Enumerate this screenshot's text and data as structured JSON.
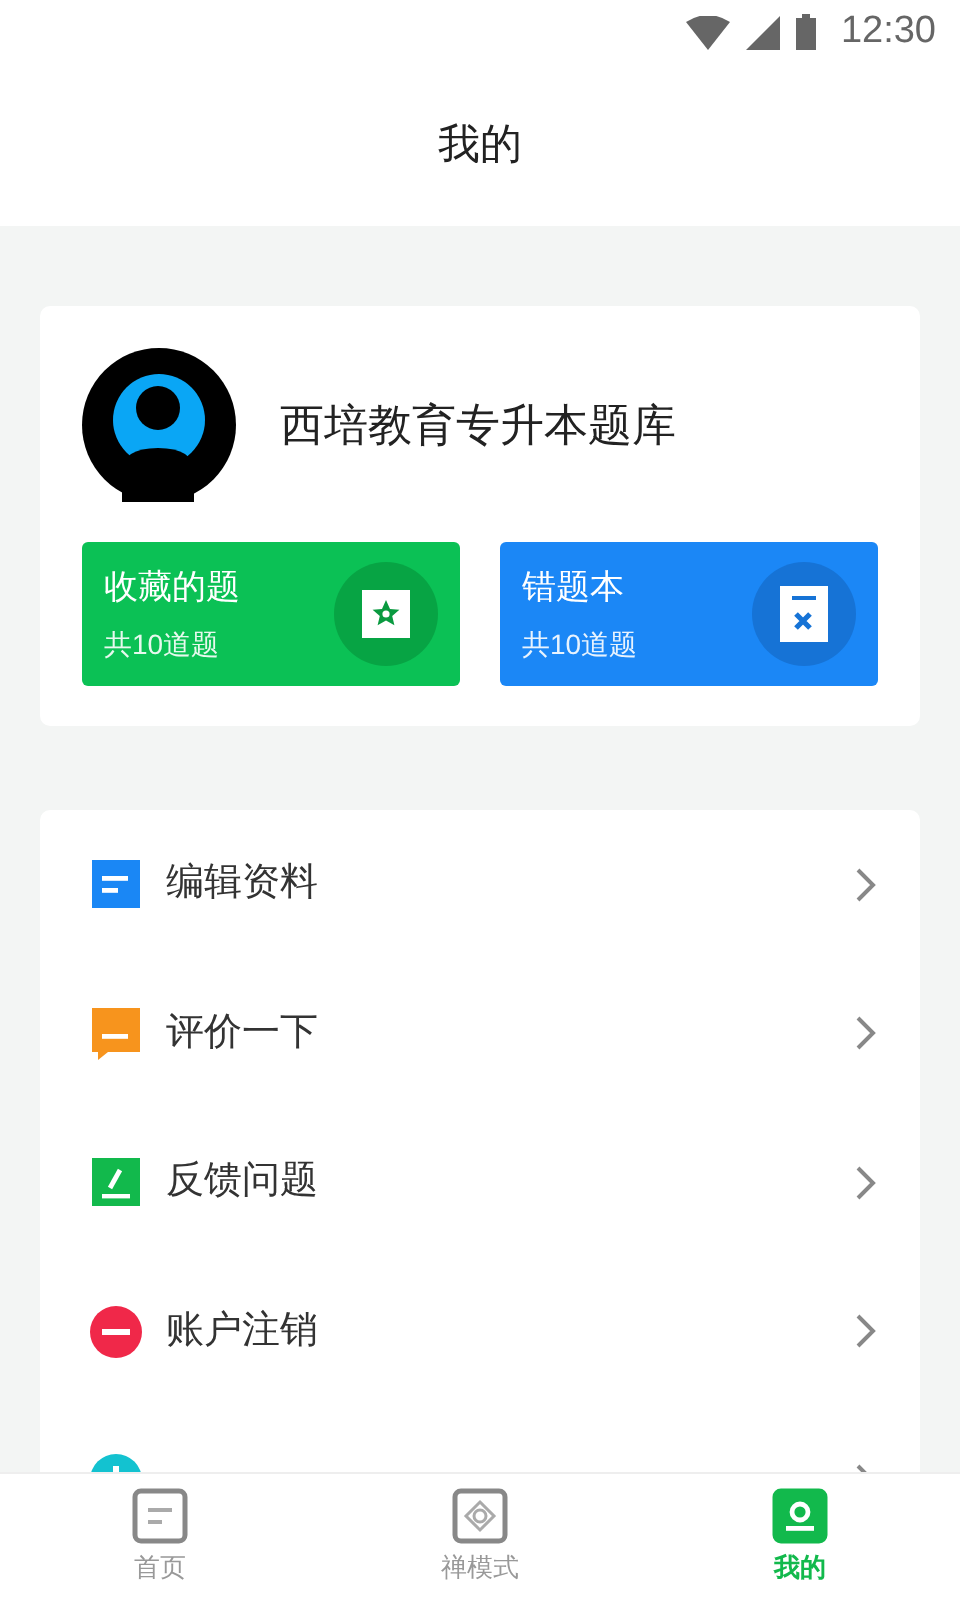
{
  "status_bar": {
    "time": "12:30"
  },
  "header": {
    "title": "我的"
  },
  "profile": {
    "name": "西培教育专升本题库"
  },
  "shortcuts": [
    {
      "kind": "favorites",
      "title": "收藏的题",
      "count": "共10道题"
    },
    {
      "kind": "mistakes",
      "title": "错题本",
      "count": "共10道题"
    }
  ],
  "menu": [
    {
      "kind": "edit-profile",
      "label": "编辑资料"
    },
    {
      "kind": "rate",
      "label": "评价一下"
    },
    {
      "kind": "feedback",
      "label": "反馈问题"
    },
    {
      "kind": "delete-account",
      "label": "账户注销"
    },
    {
      "kind": "about"
    }
  ],
  "tabs": [
    {
      "kind": "home",
      "label": "首页",
      "selected": false
    },
    {
      "kind": "zen",
      "label": "禅模式",
      "selected": false
    },
    {
      "kind": "me",
      "label": "我的",
      "selected": true
    }
  ]
}
